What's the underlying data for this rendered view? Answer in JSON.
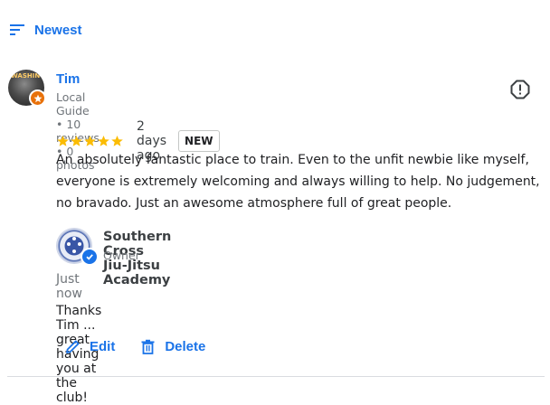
{
  "sort": {
    "label": "Newest",
    "icon": "sort-icon"
  },
  "review": {
    "author": {
      "name": "Tim",
      "meta": "Local Guide • 10 reviews • 0 photos",
      "avatar_text": "WASHING",
      "badge_icon": "local-guide-star-icon"
    },
    "rating": 5,
    "date": "2 days ago",
    "badge": "NEW",
    "text": "An absolutely fantastic place to train. Even to the unfit newbie like myself, everyone is extremely welcoming and always willing to help. No judgement, no bravado. Just an awesome atmosphere full of great people.",
    "report_icon": "report-icon"
  },
  "owner_reply": {
    "name": "Southern Cross Jiu-Jitsu Academy",
    "role": "Owner",
    "time": "Just now",
    "text": "Thanks Tim ... great having you at the club!",
    "verified_icon": "verified-check-icon"
  },
  "actions": {
    "edit_label": "Edit",
    "delete_label": "Delete"
  },
  "colors": {
    "accent": "#1a73e8",
    "star": "#fbbc04",
    "guide_badge": "#e8710a",
    "muted": "#70757a"
  }
}
